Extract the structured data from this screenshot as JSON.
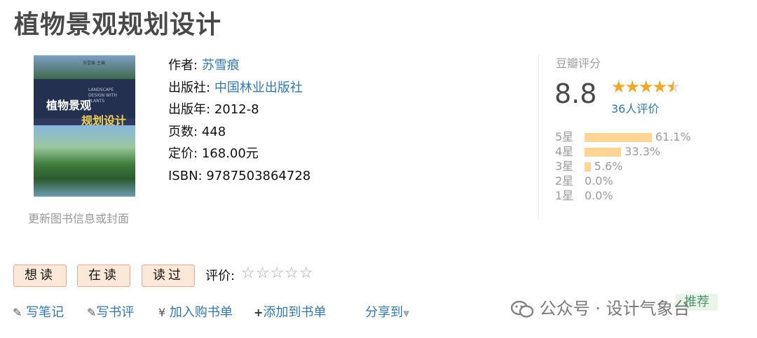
{
  "book": {
    "title": "植物景观规划设计",
    "cover": {
      "title_line1": "植物景观",
      "title_line2": "规划设计",
      "small_text": "苏雪痕 主编",
      "english_text": "LANDSCAPE DESIGN WITH PLANTS"
    },
    "update_link": "更新图书信息或封面",
    "meta": {
      "author_label": "作者:",
      "author": "苏雪痕",
      "publisher_label": "出版社:",
      "publisher": "中国林业出版社",
      "year_label": "出版年:",
      "year": "2012-8",
      "pages_label": "页数:",
      "pages": "448",
      "price_label": "定价:",
      "price": "168.00元",
      "isbn_label": "ISBN:",
      "isbn": "9787503864728"
    }
  },
  "rating": {
    "label": "豆瓣评分",
    "score": "8.8",
    "stars_value": 4.5,
    "count_text": "36人评价",
    "distribution": [
      {
        "label": "5星",
        "percent": 61.1,
        "text": "61.1%"
      },
      {
        "label": "4星",
        "percent": 33.3,
        "text": "33.3%"
      },
      {
        "label": "3星",
        "percent": 5.6,
        "text": "5.6%"
      },
      {
        "label": "2星",
        "percent": 0.0,
        "text": "0.0%"
      },
      {
        "label": "1星",
        "percent": 0.0,
        "text": "0.0%"
      }
    ]
  },
  "status_buttons": {
    "want": "想读",
    "reading": "在读",
    "read": "读过"
  },
  "evaluate": {
    "label": "评价:",
    "stars": "☆☆☆☆☆"
  },
  "actions": {
    "note": "写笔记",
    "review": "写书评",
    "cart": "加入购书单",
    "add_list": "添加到书单",
    "share": "分享到",
    "recommend": "推荐"
  },
  "icons": {
    "note": "pencil-icon",
    "review": "pencil-icon",
    "cart": "yen-icon",
    "add_list": "plus-icon",
    "share_caret": "caret-down-icon"
  },
  "watermark": {
    "text": "公众号 · 设计气象台"
  },
  "colors": {
    "link": "#3377aa",
    "star": "#f5a623",
    "bar": "#ffd596",
    "button_bg": "#fbe8d8"
  }
}
